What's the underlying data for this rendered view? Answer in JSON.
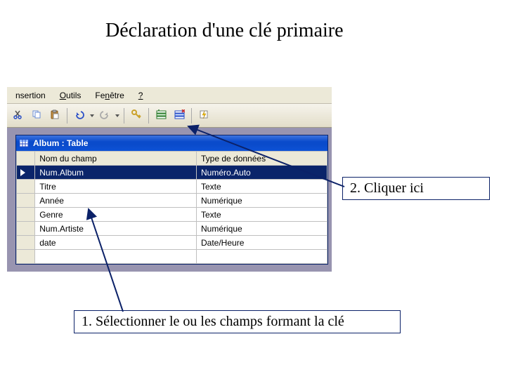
{
  "title": "Déclaration d'une clé primaire",
  "menus": {
    "insert_html": "nsertion",
    "tools_html": "<span class='mn'>O</span>utils",
    "window_html": "Fe<span class='mn'>n</span>être",
    "help_html": "<span class='mn'>?</span>"
  },
  "window": {
    "title": "Album : Table"
  },
  "columns": {
    "name": "Nom du champ",
    "type": "Type de données"
  },
  "rows": [
    {
      "name": "Num.Album",
      "type": "Numéro.Auto",
      "selected": true
    },
    {
      "name": "Titre",
      "type": "Texte",
      "selected": false
    },
    {
      "name": "Année",
      "type": "Numérique",
      "selected": false
    },
    {
      "name": "Genre",
      "type": "Texte",
      "selected": false
    },
    {
      "name": "Num.Artiste",
      "type": "Numérique",
      "selected": false
    },
    {
      "name": "date",
      "type": "Date/Heure",
      "selected": false
    }
  ],
  "callouts": {
    "step1": "1. Sélectionner le ou les champs formant la clé",
    "step2": "2. Cliquer ici"
  }
}
